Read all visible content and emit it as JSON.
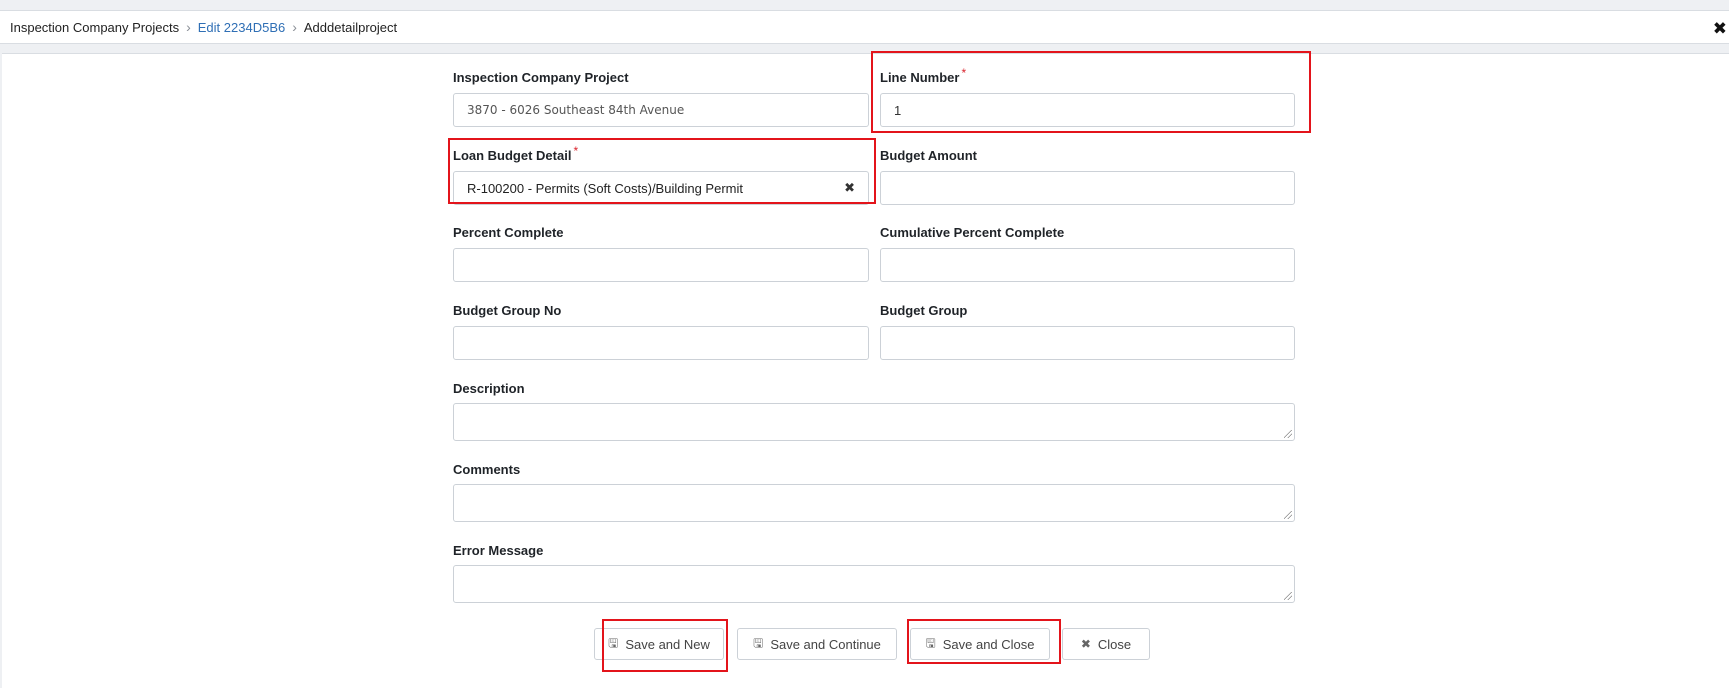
{
  "breadcrumb": {
    "items": [
      {
        "label": "Inspection Company Projects"
      },
      {
        "label": "Edit 2234D5B6"
      },
      {
        "label": "Adddetailproject"
      }
    ],
    "separator": "›"
  },
  "window": {
    "close_icon": "✖"
  },
  "form": {
    "inspection_company_project": {
      "label": "Inspection Company Project",
      "value": "3870 - 6026 Southeast 84th Avenue"
    },
    "line_number": {
      "label": "Line Number",
      "required_mark": "*",
      "value": "1"
    },
    "loan_budget_detail": {
      "label": "Loan Budget Detail",
      "required_mark": "*",
      "value": "R-100200 - Permits (Soft Costs)/Building Permit",
      "clear_icon": "✖"
    },
    "budget_amount": {
      "label": "Budget Amount",
      "value": ""
    },
    "percent_complete": {
      "label": "Percent Complete",
      "value": ""
    },
    "cumulative_percent_complete": {
      "label": "Cumulative Percent Complete",
      "value": ""
    },
    "budget_group_no": {
      "label": "Budget Group No",
      "value": ""
    },
    "budget_group": {
      "label": "Budget Group",
      "value": ""
    },
    "description": {
      "label": "Description",
      "value": ""
    },
    "comments": {
      "label": "Comments",
      "value": ""
    },
    "error_message": {
      "label": "Error Message",
      "value": ""
    }
  },
  "actions": {
    "save_and_new": {
      "label": "Save and New",
      "icon": "🖫"
    },
    "save_and_continue": {
      "label": "Save and Continue",
      "icon": "🖫"
    },
    "save_and_close": {
      "label": "Save and Close",
      "icon": "🖫"
    },
    "close": {
      "label": "Close",
      "icon": "✖"
    }
  },
  "colors": {
    "highlight": "#e3141b",
    "link": "#2f6fb5",
    "required": "#d9232d"
  }
}
